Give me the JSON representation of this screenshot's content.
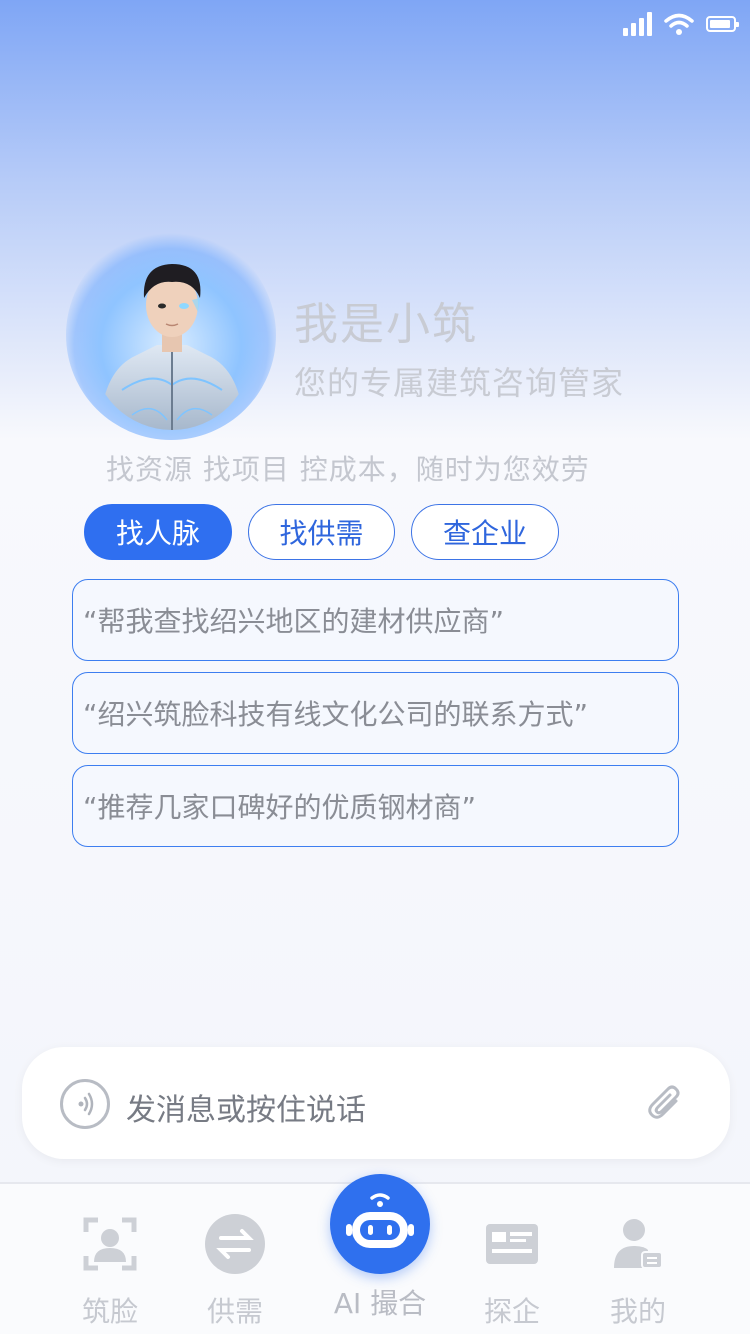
{
  "hero": {
    "title": "我是小筑",
    "subtitle": "您的专属建筑咨询管家",
    "tagline": "找资源 找项目 控成本，随时为您效劳"
  },
  "chips": [
    {
      "label": "找人脉",
      "active": true
    },
    {
      "label": "找供需",
      "active": false
    },
    {
      "label": "查企业",
      "active": false
    }
  ],
  "suggestions": [
    "“帮我查找绍兴地区的建材供应商”",
    "“绍兴筑脸科技有线文化公司的联系方式”",
    "“推荐几家口碑好的优质钢材商”"
  ],
  "input": {
    "placeholder": "发消息或按住说话"
  },
  "tabs": [
    {
      "label": "筑脸",
      "icon": "face-scan-icon"
    },
    {
      "label": "供需",
      "icon": "swap-icon"
    },
    {
      "label": "AI 撮合",
      "icon": "robot-icon"
    },
    {
      "label": "探企",
      "icon": "company-card-icon"
    },
    {
      "label": "我的",
      "icon": "profile-icon"
    }
  ],
  "colors": {
    "accent": "#2f6ff0",
    "inactive_tab": "#c6c9d0"
  }
}
